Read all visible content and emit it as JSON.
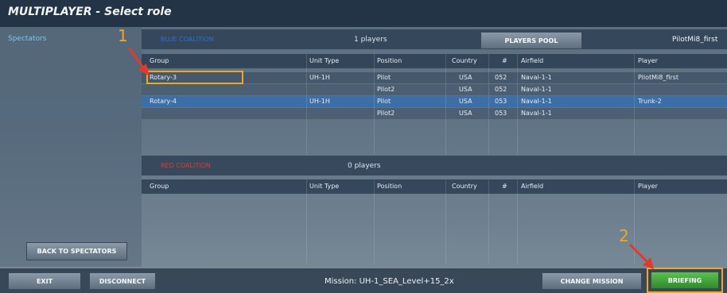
{
  "window": {
    "title": "MULTIPLAYER - Select role"
  },
  "sidebar": {
    "spectators_label": "Spectators",
    "back_to_spectators": "BACK TO SPECTATORS"
  },
  "blue": {
    "name": "BLUE COALITION",
    "players_count": "1 players",
    "players_pool_button": "PLAYERS POOL",
    "current_player": "PilotMi8_first",
    "columns": [
      "Group",
      "Unit Type",
      "Position",
      "Country",
      "#",
      "Airfield",
      "Player"
    ],
    "rows": [
      {
        "group": "Rotary-3",
        "unit": "UH-1H",
        "position": "Pilot",
        "country": "USA",
        "num": "052",
        "airfield": "Naval-1-1",
        "player": "PilotMi8_first"
      },
      {
        "group": "",
        "unit": "",
        "position": "Pilot2",
        "country": "USA",
        "num": "052",
        "airfield": "Naval-1-1",
        "player": ""
      },
      {
        "group": "Rotary-4",
        "unit": "UH-1H",
        "position": "Pilot",
        "country": "USA",
        "num": "053",
        "airfield": "Naval-1-1",
        "player": "Trunk-2"
      },
      {
        "group": "",
        "unit": "",
        "position": "Pilot2",
        "country": "USA",
        "num": "053",
        "airfield": "Naval-1-1",
        "player": ""
      }
    ]
  },
  "red": {
    "name": "RED COALITION",
    "players_count": "0 players",
    "columns": [
      "Group",
      "Unit Type",
      "Position",
      "Country",
      "#",
      "Airfield",
      "Player"
    ]
  },
  "footer": {
    "exit": "EXIT",
    "disconnect": "DISCONNECT",
    "mission": "Mission: UH-1_SEA_Level+15_2x",
    "change_mission": "CHANGE MISSION",
    "briefing": "BRIEFING"
  },
  "annotations": {
    "marker1": "1",
    "marker2": "2",
    "color": "#f0a824"
  },
  "colors": {
    "blue_coalition": "#2f6fd0",
    "red_coalition": "#e03a30",
    "selected_row": "#3c6ea8",
    "briefing": "#3fa53a"
  }
}
